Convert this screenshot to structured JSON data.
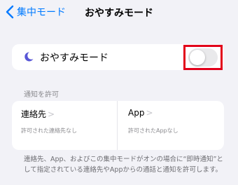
{
  "nav": {
    "back_label": "集中モード",
    "title": "おやすみモード"
  },
  "dnd": {
    "label": "おやすみモード",
    "toggle_on": false,
    "icon": "moon-icon"
  },
  "permissions": {
    "header": "通知を許可",
    "people": {
      "title": "連絡先",
      "subtitle": "許可された連絡先なし"
    },
    "apps": {
      "title": "App",
      "subtitle": "許可されたAppなし"
    }
  },
  "footer": "連絡先、App、およびこの集中モードがオンの場合に“即時通知”として指定されている連絡先やAppからの通話と通知を許可します。",
  "colors": {
    "accent": "#007aff",
    "moon": "#5856d6",
    "highlight": "#e2001a"
  }
}
